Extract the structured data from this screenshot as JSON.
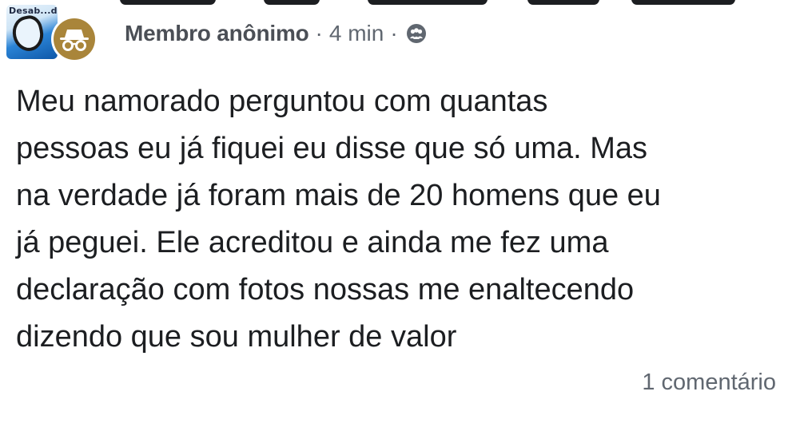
{
  "group": {
    "logo_text": "Desab...do",
    "logo_icon": "speech-bubble-icon"
  },
  "post": {
    "author": "Membro anônimo",
    "separator": "·",
    "time": "4 min",
    "privacy_icon": "group-members-icon",
    "avatar_icon": "incognito-icon",
    "body": "Meu namorado perguntou com quantas\npessoas eu já fiquei eu disse que só uma. Mas\nna verdade já foram mais de 20 homens que eu\njá peguei. Ele acreditou e ainda me fez uma\ndeclaração com fotos nossas me enaltecendo\ndizendo que sou mulher de valor",
    "comments": "1 comentário"
  },
  "colors": {
    "author_text": "#4b4f56",
    "meta_text": "#606770",
    "body_text": "#1c1e21",
    "avatar_gold": "#a9853a",
    "logo_blue": "#0d57a8"
  }
}
